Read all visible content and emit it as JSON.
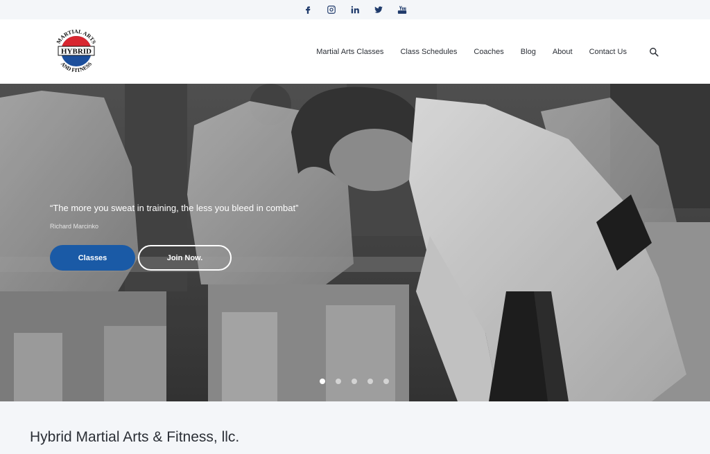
{
  "social": [
    {
      "icon": "facebook-icon"
    },
    {
      "icon": "instagram-icon"
    },
    {
      "icon": "linkedin-icon"
    },
    {
      "icon": "twitter-icon"
    },
    {
      "icon": "youtube-icon"
    }
  ],
  "logo": {
    "top_text": "MARTIAL ARTS",
    "middle_text": "HYBRID",
    "bottom_text": "AND FITNESS"
  },
  "nav": {
    "items": [
      {
        "label": "Martial Arts Classes"
      },
      {
        "label": "Class Schedules"
      },
      {
        "label": "Coaches"
      },
      {
        "label": "Blog"
      },
      {
        "label": "About"
      },
      {
        "label": "Contact Us"
      }
    ]
  },
  "hero": {
    "quote": "“The more you sweat in training, the less you bleed in combat”",
    "author": "Richard Marcinko",
    "primary_button": "Classes",
    "secondary_button": "Join Now.",
    "slide_count": 5,
    "active_slide": 1
  },
  "company_name": "Hybrid Martial Arts & Fitness, llc.",
  "colors": {
    "accent": "#1a5aa6",
    "nav_icon": "#1f3a6b",
    "logo_red": "#d8262f",
    "logo_blue": "#1c4f9c"
  }
}
